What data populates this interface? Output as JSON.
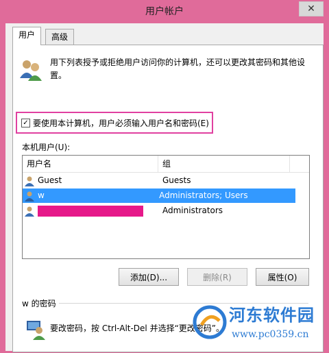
{
  "window": {
    "title": "用户帐户",
    "close_glyph": "✕"
  },
  "tabs": [
    {
      "label": "用户"
    },
    {
      "label": "高级"
    }
  ],
  "intro_text": "用下列表授予或拒绝用户访问你的计算机，还可以更改其密码和其他设置。",
  "require_login": {
    "label": "要使用本计算机，用户必须输入用户名和密码(E)",
    "checked": true,
    "check_glyph": "✓"
  },
  "local_users_label": "本机用户(U):",
  "table": {
    "columns": [
      "用户名",
      "组",
      ""
    ],
    "rows": [
      {
        "name": "Guest",
        "group": "Guests",
        "selected": false
      },
      {
        "name": "w",
        "group": "Administrators; Users",
        "selected": true
      },
      {
        "name": "",
        "group": "Administrators",
        "selected": false,
        "name_redacted": true
      }
    ]
  },
  "buttons": {
    "add": "添加(D)...",
    "remove": "删除(R)",
    "properties": "属性(O)"
  },
  "password_group": {
    "label": "w 的密码",
    "text": "要改密码，按 Ctrl-Alt-Del 并选择“更改密码”。"
  },
  "watermark": {
    "title": "河东软件园",
    "url": "www.pc0359.cn"
  },
  "colors": {
    "accent_border": "#e06b9a",
    "selection": "#3399ff",
    "highlight_outline": "#e040a0",
    "redaction": "#e6198a",
    "watermark": "#2d7bd3"
  }
}
